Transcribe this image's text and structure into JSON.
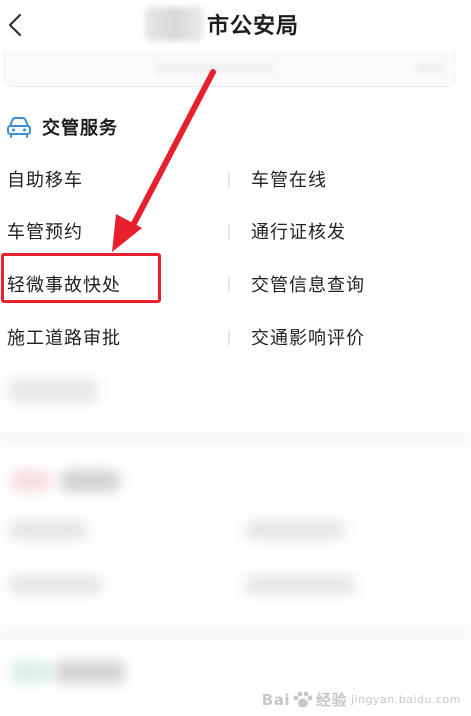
{
  "header": {
    "title_suffix": "市公安局",
    "back_icon": "chevron-left-icon"
  },
  "section": {
    "icon": "car-icon",
    "title": "交管服务"
  },
  "services": [
    {
      "label": "自助移车"
    },
    {
      "label": "车管在线"
    },
    {
      "label": "车管预约"
    },
    {
      "label": "通行证核发"
    },
    {
      "label": "轻微事故快处"
    },
    {
      "label": "交管信息查询"
    },
    {
      "label": "施工道路审批"
    },
    {
      "label": "交通影响评价"
    }
  ],
  "annotation": {
    "highlight_color": "#e8202d",
    "highlighted_item": "轻微事故快处"
  },
  "watermark": {
    "brand": "Bai",
    "brand_tail": "经验",
    "sub": "jingyan.baidu.com"
  },
  "colors": {
    "accent": "#3c8fd6",
    "annotation": "#e8202d"
  }
}
